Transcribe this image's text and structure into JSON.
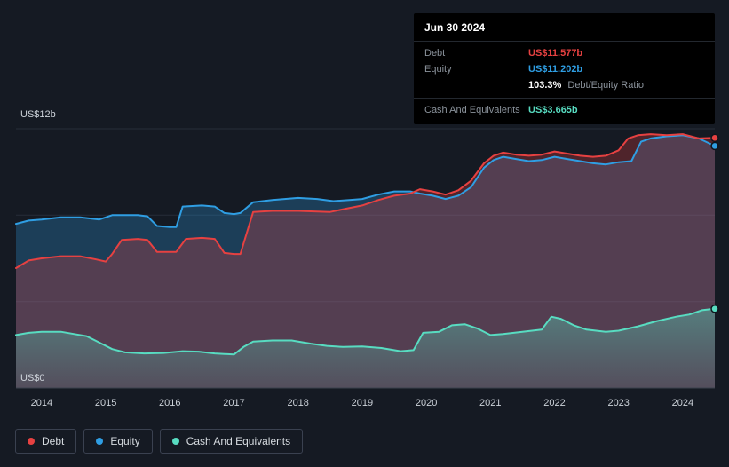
{
  "tooltip": {
    "date": "Jun 30 2024",
    "rows": [
      {
        "label": "Debt",
        "value": "US$11.577b",
        "color": "#e64141"
      },
      {
        "label": "Equity",
        "value": "US$11.202b",
        "color": "#2f9ee3"
      },
      {
        "label": "",
        "value_bold": "103.3%",
        "value_rest": "Debt/Equity Ratio"
      },
      {
        "label": "Cash And Equivalents",
        "value": "US$3.665b",
        "color": "#58dcc1"
      }
    ]
  },
  "axis": {
    "y_top_label": "US$12b",
    "y_bottom_label": "US$0",
    "x_ticks": [
      "2014",
      "2015",
      "2016",
      "2017",
      "2018",
      "2019",
      "2020",
      "2021",
      "2022",
      "2023",
      "2024"
    ]
  },
  "legend": {
    "items": [
      {
        "label": "Debt",
        "color": "#e64141"
      },
      {
        "label": "Equity",
        "color": "#2f9ee3"
      },
      {
        "label": "Cash And Equivalents",
        "color": "#58dcc1"
      }
    ]
  },
  "chart_data": {
    "type": "area",
    "y_unit": "US$ billions",
    "y_range": [
      0,
      12
    ],
    "x_range": [
      2013.6,
      2024.5
    ],
    "gridlines": [
      0,
      4,
      8,
      12
    ],
    "legend_position": "bottom-left",
    "series": [
      {
        "name": "Debt",
        "color": "#e64141",
        "end_label": "US$11.577b",
        "x": [
          2013.6,
          2013.8,
          2014.0,
          2014.3,
          2014.6,
          2014.85,
          2015.0,
          2015.1,
          2015.25,
          2015.5,
          2015.65,
          2015.8,
          2016.0,
          2016.1,
          2016.25,
          2016.5,
          2016.7,
          2016.85,
          2017.0,
          2017.1,
          2017.3,
          2017.6,
          2018.0,
          2018.5,
          2018.75,
          2019.0,
          2019.25,
          2019.5,
          2019.75,
          2019.9,
          2020.1,
          2020.3,
          2020.5,
          2020.7,
          2020.9,
          2021.05,
          2021.2,
          2021.4,
          2021.6,
          2021.8,
          2022.0,
          2022.2,
          2022.4,
          2022.6,
          2022.8,
          2023.0,
          2023.15,
          2023.3,
          2023.5,
          2023.75,
          2024.0,
          2024.25,
          2024.5
        ],
        "values": [
          5.55,
          5.9,
          6.0,
          6.1,
          6.1,
          5.95,
          5.85,
          6.2,
          6.85,
          6.9,
          6.85,
          6.3,
          6.3,
          6.3,
          6.9,
          6.95,
          6.9,
          6.25,
          6.2,
          6.2,
          8.15,
          8.2,
          8.2,
          8.15,
          8.3,
          8.45,
          8.7,
          8.9,
          9.0,
          9.2,
          9.1,
          8.95,
          9.15,
          9.6,
          10.4,
          10.75,
          10.9,
          10.8,
          10.75,
          10.8,
          10.95,
          10.85,
          10.75,
          10.7,
          10.75,
          11.0,
          11.55,
          11.7,
          11.75,
          11.7,
          11.75,
          11.55,
          11.577
        ]
      },
      {
        "name": "Equity",
        "color": "#2f9ee3",
        "end_label": "US$11.202b",
        "x": [
          2013.6,
          2013.8,
          2014.0,
          2014.3,
          2014.6,
          2014.9,
          2015.1,
          2015.25,
          2015.5,
          2015.65,
          2015.8,
          2016.0,
          2016.1,
          2016.2,
          2016.5,
          2016.7,
          2016.85,
          2017.0,
          2017.1,
          2017.3,
          2017.6,
          2018.0,
          2018.3,
          2018.55,
          2018.8,
          2019.0,
          2019.25,
          2019.5,
          2019.75,
          2019.9,
          2020.1,
          2020.3,
          2020.5,
          2020.7,
          2020.9,
          2021.05,
          2021.2,
          2021.4,
          2021.6,
          2021.8,
          2022.0,
          2022.2,
          2022.4,
          2022.6,
          2022.8,
          2023.0,
          2023.2,
          2023.35,
          2023.5,
          2023.75,
          2024.0,
          2024.25,
          2024.5
        ],
        "values": [
          7.6,
          7.75,
          7.8,
          7.9,
          7.9,
          7.8,
          8.0,
          8.0,
          8.0,
          7.95,
          7.5,
          7.45,
          7.45,
          8.4,
          8.45,
          8.4,
          8.1,
          8.05,
          8.1,
          8.6,
          8.7,
          8.8,
          8.75,
          8.65,
          8.7,
          8.75,
          8.95,
          9.1,
          9.1,
          9.0,
          8.9,
          8.75,
          8.9,
          9.3,
          10.2,
          10.55,
          10.7,
          10.6,
          10.5,
          10.55,
          10.7,
          10.6,
          10.5,
          10.4,
          10.35,
          10.45,
          10.5,
          11.4,
          11.55,
          11.65,
          11.7,
          11.55,
          11.202
        ]
      },
      {
        "name": "Cash And Equivalents",
        "color": "#58dcc1",
        "end_label": "US$3.665b",
        "x": [
          2013.6,
          2013.8,
          2014.0,
          2014.3,
          2014.5,
          2014.7,
          2014.9,
          2015.1,
          2015.3,
          2015.6,
          2015.9,
          2016.2,
          2016.45,
          2016.7,
          2017.0,
          2017.15,
          2017.3,
          2017.6,
          2017.9,
          2018.2,
          2018.45,
          2018.7,
          2019.0,
          2019.3,
          2019.6,
          2019.8,
          2019.95,
          2020.2,
          2020.4,
          2020.6,
          2020.8,
          2021.0,
          2021.2,
          2021.5,
          2021.8,
          2021.95,
          2022.1,
          2022.3,
          2022.5,
          2022.8,
          2023.0,
          2023.3,
          2023.6,
          2023.9,
          2024.1,
          2024.3,
          2024.5
        ],
        "values": [
          2.45,
          2.55,
          2.6,
          2.6,
          2.5,
          2.4,
          2.1,
          1.8,
          1.65,
          1.6,
          1.62,
          1.7,
          1.68,
          1.6,
          1.55,
          1.9,
          2.15,
          2.2,
          2.2,
          2.05,
          1.95,
          1.9,
          1.92,
          1.85,
          1.7,
          1.75,
          2.55,
          2.6,
          2.9,
          2.95,
          2.75,
          2.45,
          2.5,
          2.6,
          2.7,
          3.3,
          3.2,
          2.9,
          2.7,
          2.6,
          2.65,
          2.85,
          3.1,
          3.3,
          3.4,
          3.6,
          3.665
        ]
      }
    ]
  }
}
